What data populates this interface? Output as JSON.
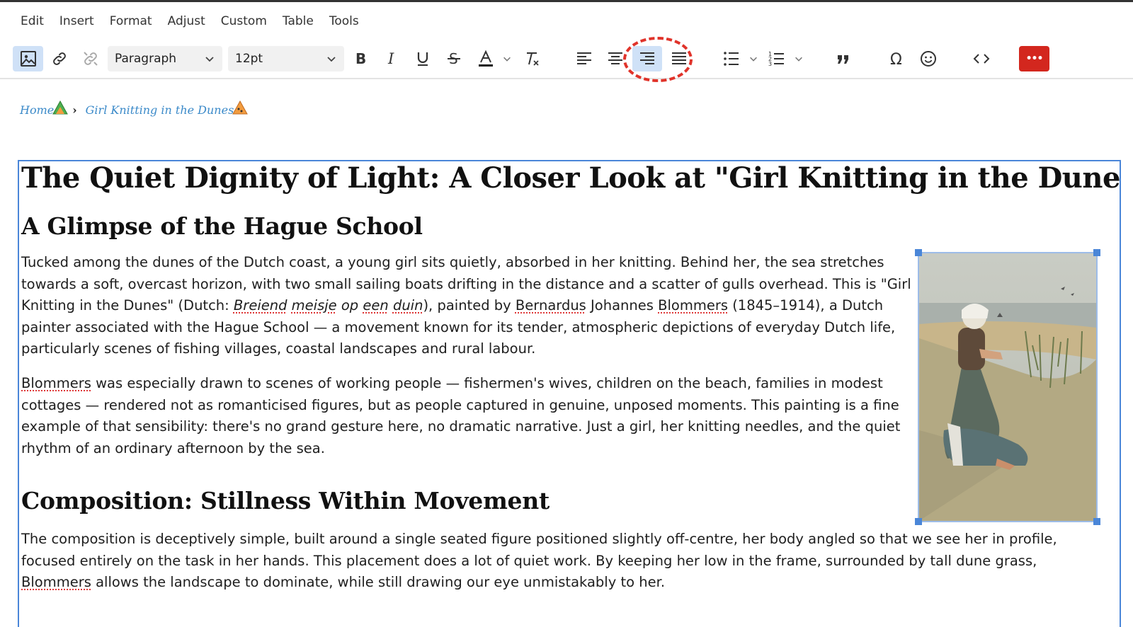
{
  "menu": [
    "Edit",
    "Insert",
    "Format",
    "Adjust",
    "Custom",
    "Table",
    "Tools"
  ],
  "toolbar": {
    "block_format": "Paragraph",
    "font_size": "12pt",
    "more_label": "•••",
    "highlighted_button": "align-right",
    "colors": {
      "accent": "#4a86d8",
      "danger": "#d3271e",
      "active_bg": "#cfe1f7",
      "highlight_ring": "#e0332a"
    }
  },
  "breadcrumb": {
    "home": "Home",
    "current": "Girl Knitting in the Dunes"
  },
  "content": {
    "title": "The Quiet Dignity of Light: A Closer Look at \"Girl Knitting in the Dunes\"",
    "section1_heading": "A Glimpse of the Hague School",
    "p1": {
      "a": "Tucked among the dunes of the Dutch coast, a young girl sits quietly, absorbed in her knitting. Behind her, the sea stretches towards a soft, overcast horizon, with two small sailing boats drifting in the distance and a scatter of gulls overhead. This is \"Girl Knitting in the Dunes\" (Dutch: ",
      "w1": "Breiend",
      "w2": "meisje",
      "w3": "op",
      "w4": "een",
      "w5": "duin",
      "b": "), painted by ",
      "w6": "Bernardus",
      "c": " Johannes ",
      "w7": "Blommers",
      "d": " (1845–1914), a Dutch painter associated with the Hague School — a movement known for its tender, atmospheric depictions of everyday Dutch life, particularly scenes of fishing villages, coastal landscapes and rural labour."
    },
    "p2": {
      "w1": "Blommers",
      "a": " was especially drawn to scenes of working people — fishermen's wives, children on the beach, families in modest cottages — rendered not as romanticised figures, but as people captured in genuine, unposed moments. This painting is a fine example of that sensibility: there's no grand gesture here, no dramatic narrative. Just a girl, her knitting needles, and the quiet rhythm of an ordinary afternoon by the sea."
    },
    "section2_heading": "Composition: Stillness Within Movement",
    "p3": {
      "a": "The composition is deceptively simple, built around a single seated figure positioned slightly off-centre, her body angled so that we see her in profile, focused entirely on the task in her hands. This placement does a lot of quiet work. By keeping her low in the frame, surrounded by tall dune grass, ",
      "w1": "Blommers",
      "b": " allows the landscape to dominate, while still drawing our eye unmistakably to her."
    }
  }
}
